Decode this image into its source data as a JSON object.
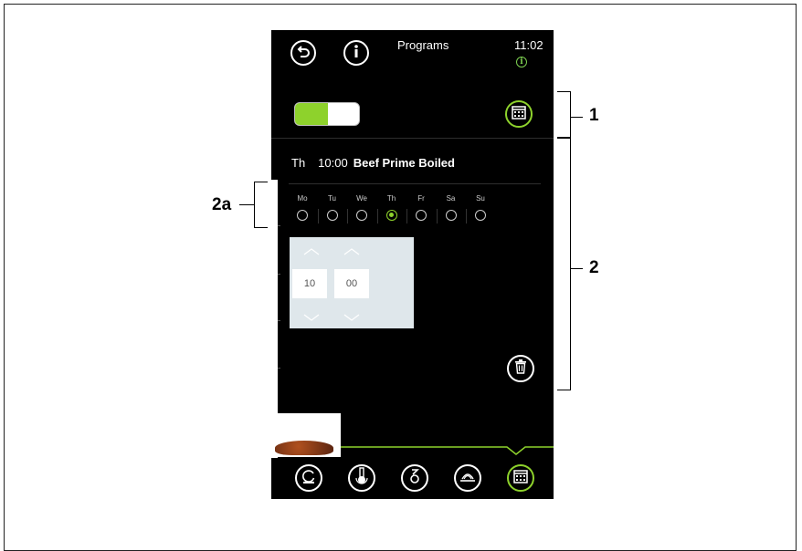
{
  "header": {
    "title": "Programs",
    "clock": "11:02",
    "back_icon": "back-icon",
    "info_icon": "info-icon",
    "clock_info_glyph": "i"
  },
  "schedule": {
    "enabled": true,
    "entry": {
      "day": "Th",
      "time": "10:00",
      "program": "Beef Prime Boiled"
    },
    "days": [
      {
        "label": "Mo",
        "selected": false
      },
      {
        "label": "Tu",
        "selected": false
      },
      {
        "label": "We",
        "selected": false
      },
      {
        "label": "Th",
        "selected": true
      },
      {
        "label": "Fr",
        "selected": false
      },
      {
        "label": "Sa",
        "selected": false
      },
      {
        "label": "Su",
        "selected": false
      }
    ],
    "time_picker": {
      "hour": "10",
      "minute": "00"
    }
  },
  "bottom_nav": [
    {
      "icon": "steam-cleaning-icon",
      "active": false
    },
    {
      "icon": "thermometer-icon",
      "active": false
    },
    {
      "icon": "delta-t-icon",
      "active": false
    },
    {
      "icon": "plate-icon",
      "active": false
    },
    {
      "icon": "calendar-icon",
      "active": true
    }
  ],
  "callouts": {
    "one": "1",
    "two": "2",
    "two_a": "2a"
  },
  "colors": {
    "accent": "#8ed22c",
    "screen_bg": "#000000",
    "picker_bg": "#dfe7eb"
  }
}
